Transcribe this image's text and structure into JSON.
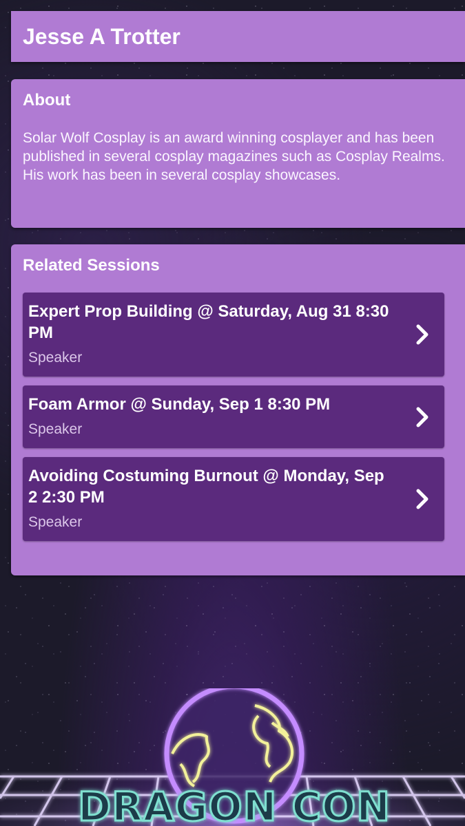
{
  "header": {
    "title": "Jesse A Trotter"
  },
  "about": {
    "heading": "About",
    "text": "Solar Wolf Cosplay is an award winning cosplayer and has been published in several cosplay magazines such as Cosplay Realms. His work has been in several cosplay showcases."
  },
  "sessions": {
    "heading": "Related Sessions",
    "items": [
      {
        "title": "Expert Prop Building @ Saturday, Aug 31 8:30 PM",
        "role": "Speaker"
      },
      {
        "title": "Foam Armor @ Sunday, Sep 1 8:30 PM",
        "role": "Speaker"
      },
      {
        "title": "Avoiding Costuming Burnout @ Monday, Sep 2 2:30 PM",
        "role": "Speaker"
      }
    ]
  },
  "branding": {
    "logo_text": "DRAGON CON"
  },
  "colors": {
    "card": "#b07bd3",
    "session": "#5b2a7d",
    "background": "#1c1a2a",
    "neon_yellow": "#f3f19a",
    "neon_purple": "#c48cff",
    "neon_teal": "#7fe0d0"
  },
  "icons": {
    "chevron": "chevron-right-icon"
  }
}
